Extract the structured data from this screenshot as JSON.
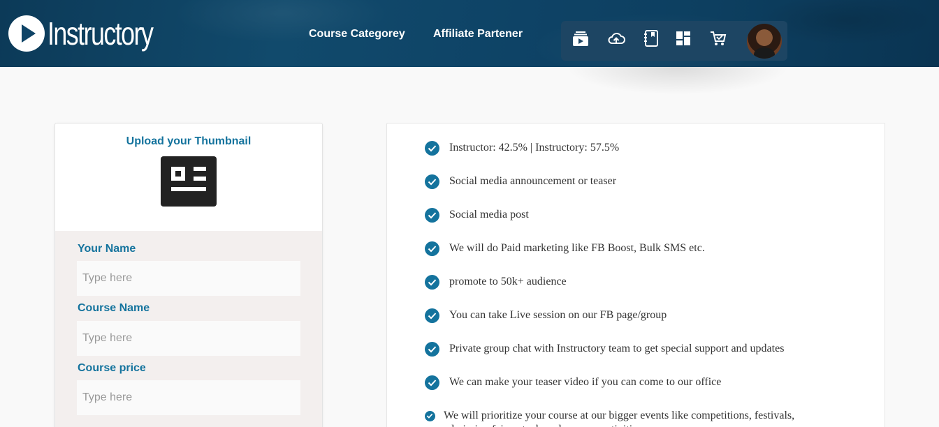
{
  "brand": {
    "name": "Instructory"
  },
  "nav": {
    "links": [
      "Course Categorey",
      "Affiliate Partener"
    ]
  },
  "iconbar": {
    "icons": [
      "video-library-icon",
      "cloud-upload-icon",
      "notebook-icon",
      "dashboard-icon",
      "cart-icon"
    ]
  },
  "upload": {
    "title": "Upload your Thumbnail"
  },
  "form": {
    "name_label": "Your Name",
    "name_placeholder": "Type here",
    "course_label": "Course Name",
    "course_placeholder": "Type here",
    "price_label": "Course price",
    "price_placeholder": "Type here"
  },
  "features": [
    "Instructor: 42.5% | Instructory: 57.5%",
    "Social media announcement or teaser",
    "Social media post",
    "We will do Paid marketing like FB Boost, Bulk SMS etc.",
    "promote to 50k+ audience",
    "You can take Live session on our FB page/group",
    "Private group chat with Instructory team to get special support and updates",
    "We can make your teaser video if you can come to our office",
    "We will prioritize your course at our bigger events like competitions, festivals, admission fairs, etc. based on your activities."
  ],
  "colors": {
    "accent": "#14739d",
    "header": "#0e4366"
  }
}
